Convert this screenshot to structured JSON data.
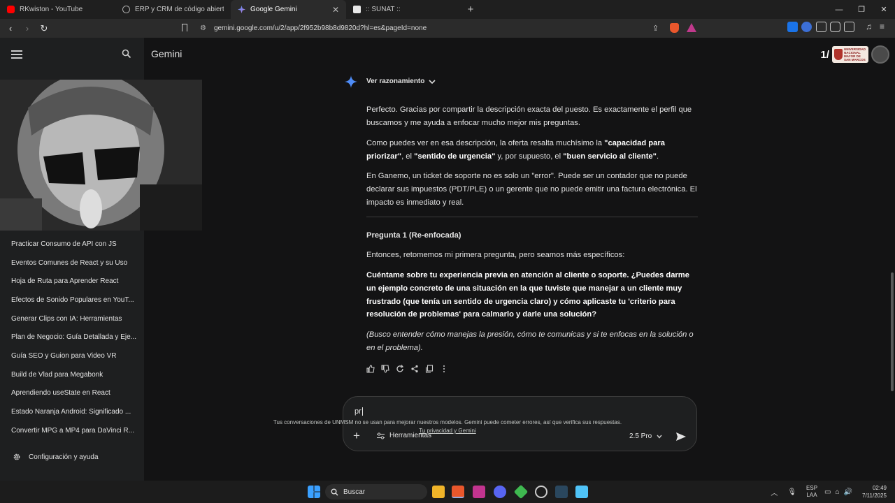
{
  "browser": {
    "tabs": [
      {
        "title": "RKwiston - YouTube",
        "favicon_color": "#ff0000"
      },
      {
        "title": "ERP y CRM de código abierto | Odoo",
        "favicon_color": "#714b67"
      },
      {
        "title": "Google Gemini",
        "favicon_color": "#7aa7f7"
      },
      {
        "title": ":: SUNAT ::",
        "favicon_color": "#e8e8e8"
      }
    ],
    "new_tab": "+",
    "url": "gemini.google.com/u/2/app/2f952b98b8d9820d?hl=es&pageId=none",
    "window_controls": {
      "minimize": "—",
      "restore": "❐",
      "close": "✕"
    }
  },
  "sidebar": {
    "chats": [
      "Practicar Consumo de API con JS",
      "Eventos Comunes de React y su Uso",
      "Hoja de Ruta para Aprender React",
      "Efectos de Sonido Populares en YouT...",
      "Generar Clips con IA: Herramientas",
      "Plan de Negocio: Guía Detallada y Eje...",
      "Guía SEO y Guion para Video VR",
      "Build de Vlad para Megabonk",
      "Aprendiendo useState en React",
      "Estado Naranja Android: Significado ...",
      "Convertir MPG a MP4 para DaVinci R..."
    ],
    "settings": "Configuración y ayuda"
  },
  "header": {
    "title": "Gemini",
    "page_count": "1/",
    "badge": {
      "line1": "UNIVERSIDAD",
      "line2": "NACIONAL",
      "line3": "MAYOR DE",
      "line4": "SAN MARCOS"
    }
  },
  "response": {
    "reasoning": "Ver razonamiento",
    "p1": "Perfecto. Gracias por compartir la descripción exacta del puesto. Es exactamente el perfil que buscamos y me ayuda a enfocar mucho mejor mis preguntas.",
    "p2": {
      "a": "Como puedes ver en esa descripción, la oferta resalta muchísimo la ",
      "b": "\"capacidad para priorizar\"",
      "c": ", el ",
      "d": "\"sentido de urgencia\"",
      "e": " y, por supuesto, el ",
      "f": "\"buen servicio al cliente\"",
      "g": "."
    },
    "p3": "En Ganemo, un ticket de soporte no es solo un \"error\". Puede ser un contador que no puede declarar sus impuestos (PDT/PLE) o un gerente que no puede emitir una factura electrónica. El impacto es inmediato y real.",
    "heading": "Pregunta 1 (Re-enfocada)",
    "p4": "Entonces, retomemos mi primera pregunta, pero seamos más específicos:",
    "question": "Cuéntame sobre tu experiencia previa en atención al cliente o soporte. ¿Puedes darme un ejemplo concreto de una situación en la que tuviste que manejar a un cliente muy frustrado (que tenía un sentido de urgencia claro) y cómo aplicaste tu 'criterio para resolución de problemas' para calmarlo y darle una solución?",
    "note": "(Busco entender cómo manejas la presión, cómo te comunicas y si te enfocas en la solución o en el problema)."
  },
  "composer": {
    "value": "pr",
    "tools": "Herramientas",
    "model": "2.5 Pro"
  },
  "disclaimer": {
    "text": "Tus conversaciones de UNMSM no se usan para mejorar nuestros modelos. Gemini puede cometer errores, así que verifica sus respuestas.",
    "link": "Tu privacidad y Gemini"
  },
  "taskbar": {
    "search": "Buscar",
    "lang1": "ESP",
    "lang2": "LAA",
    "time": "02:49",
    "date": "7/11/2025"
  }
}
